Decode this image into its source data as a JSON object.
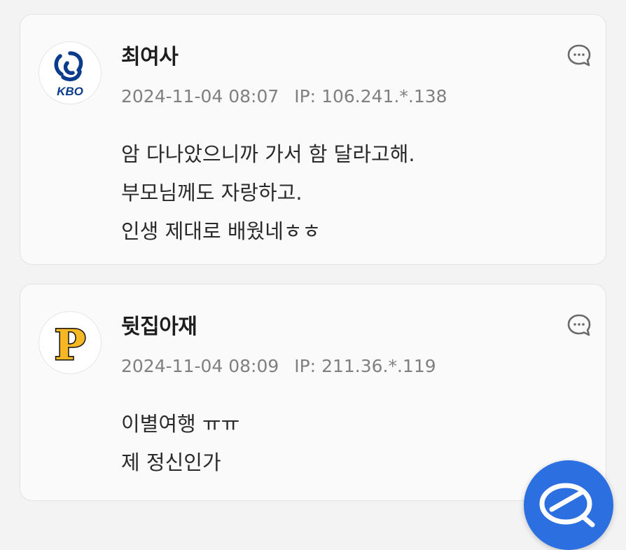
{
  "comments": [
    {
      "avatar_icon": "kbo-logo-icon",
      "avatar_text": "KBO",
      "username": "최여사",
      "date": "2024-11-04 08:07",
      "ip_label": "IP:",
      "ip": "106.241.*.138",
      "lines": [
        "암 다나았으니까 가서 함 달라고해.",
        "부모님께도 자랑하고.",
        "인생 제대로 배웠네ㅎㅎ"
      ]
    },
    {
      "avatar_icon": "pirates-p-logo-icon",
      "avatar_text": "P",
      "username": "뒷집아재",
      "date": "2024-11-04 08:09",
      "ip_label": "IP:",
      "ip": "211.36.*.119",
      "lines": [
        "이별여행 ㅠㅠ",
        "제 정신인가"
      ]
    }
  ],
  "reply_icon": "comment-bubble-icon",
  "fab_icon": "write-comment-icon",
  "colors": {
    "background": "#f3f3f3",
    "card": "#fafafa",
    "meta_text": "#808080",
    "kbo_blue": "#0b3c8c",
    "pirates_gold": "#f5b824",
    "fab_blue": "#2c6fe0"
  }
}
